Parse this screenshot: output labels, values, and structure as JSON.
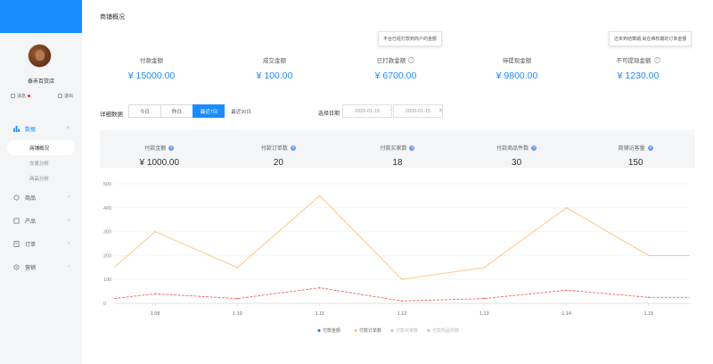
{
  "sidebar": {
    "username": "泰禾百货店",
    "actions": [
      "消息",
      "退出"
    ],
    "nav": [
      {
        "label": "数据",
        "icon": "bar-chart-icon",
        "active": true
      },
      {
        "label": "商品",
        "icon": "goods-icon"
      },
      {
        "label": "产品",
        "icon": "product-icon"
      },
      {
        "label": "订单",
        "icon": "order-icon"
      },
      {
        "label": "营销",
        "icon": "marketing-icon"
      }
    ],
    "sub_items": [
      "商铺概况",
      "交易分析",
      "商品分析"
    ]
  },
  "page": {
    "title": "商铺概况"
  },
  "stats": [
    {
      "label": "付款金额",
      "value": "¥ 15000.00"
    },
    {
      "label": "成交金额",
      "value": "¥ 100.00"
    },
    {
      "label": "已打款金额",
      "value": "¥ 6700.00"
    },
    {
      "label": "待提现金额",
      "value": "¥ 9800.00"
    },
    {
      "label": "不可提现金额",
      "value": "¥ 1230.00"
    }
  ],
  "tooltips": {
    "paid": "平台已经打款到商户的金额",
    "locked": "还未到结算期,尚在维权期的订单金额"
  },
  "filter": {
    "detail_label": "详细数据",
    "buttons": [
      "今日",
      "昨日",
      "最近7日",
      "最近30日"
    ],
    "active_index": 2,
    "date_label": "选择日期",
    "date_start": "2020-01-15",
    "date_end": "2020-01-15",
    "separator": "-",
    "clear": "x"
  },
  "metrics": [
    {
      "label": "付款金额",
      "value": "¥ 1000.00"
    },
    {
      "label": "付款订单数",
      "value": "20"
    },
    {
      "label": "付款买家数",
      "value": "18"
    },
    {
      "label": "付款商品件数",
      "value": "30"
    },
    {
      "label": "商铺访客量",
      "value": "150"
    }
  ],
  "colors": {
    "accent": "#1a8cff",
    "line_red": "#f06464",
    "line_orange": "#fcc27a",
    "legend_grey": "#c8c8c8"
  },
  "chart_data": {
    "type": "line",
    "categories": [
      "1.09",
      "1.10",
      "1.11",
      "1.12",
      "1.13",
      "1.14",
      "1.15"
    ],
    "ylim": [
      0,
      500
    ],
    "yticks": [
      "0",
      "100",
      "200",
      "300",
      "400",
      "500"
    ],
    "series": [
      {
        "name": "付款金额",
        "color": "#f06464",
        "values": [
          40,
          20,
          65,
          10,
          20,
          55,
          25
        ]
      },
      {
        "name": "付款订单数",
        "color": "#fcc27a",
        "values": [
          300,
          150,
          450,
          100,
          150,
          400,
          200
        ]
      },
      {
        "name": "付款买家数",
        "color": "#c8c8c8",
        "values": []
      },
      {
        "name": "付款商品件数",
        "color": "#c8c8c8",
        "values": []
      }
    ],
    "x_extra": [
      150,
      150
    ]
  }
}
